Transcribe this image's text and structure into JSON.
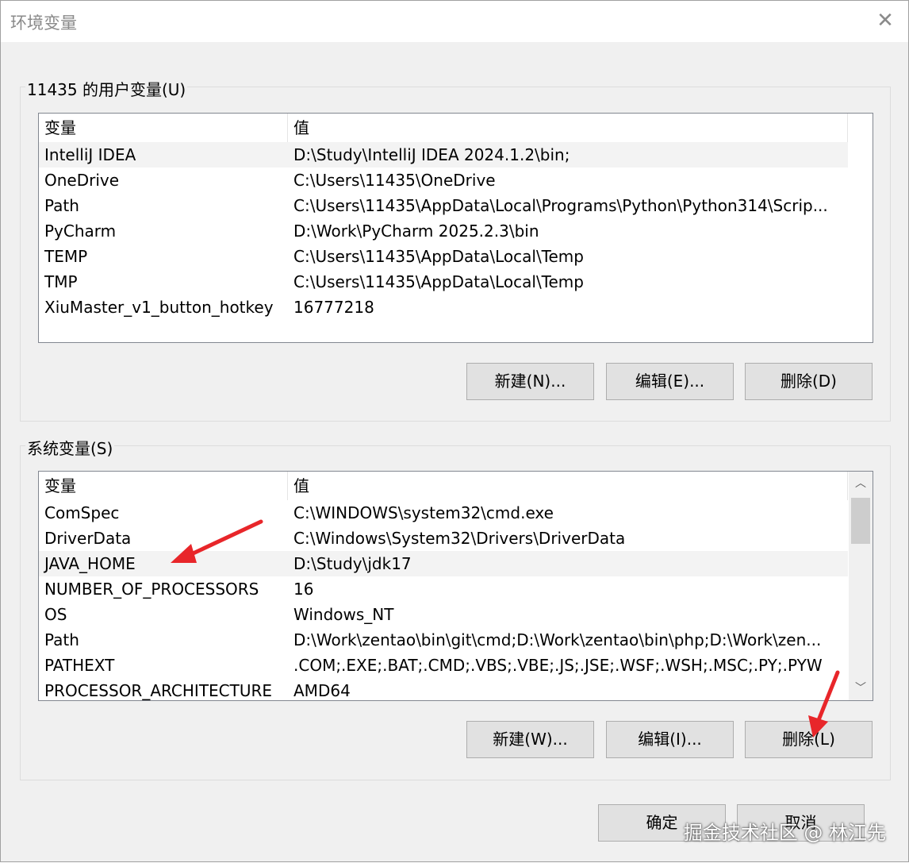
{
  "window": {
    "title": "环境变量",
    "close_icon": "close-icon"
  },
  "user_vars": {
    "label": "11435 的用户变量(U)",
    "columns": [
      "变量",
      "值"
    ],
    "rows": [
      {
        "name": "IntelliJ IDEA",
        "value": "D:\\Study\\IntelliJ IDEA 2024.1.2\\bin;"
      },
      {
        "name": "OneDrive",
        "value": "C:\\Users\\11435\\OneDrive"
      },
      {
        "name": "Path",
        "value": "C:\\Users\\11435\\AppData\\Local\\Programs\\Python\\Python314\\Scrip..."
      },
      {
        "name": "PyCharm",
        "value": "D:\\Work\\PyCharm 2025.2.3\\bin"
      },
      {
        "name": "TEMP",
        "value": "C:\\Users\\11435\\AppData\\Local\\Temp"
      },
      {
        "name": "TMP",
        "value": "C:\\Users\\11435\\AppData\\Local\\Temp"
      },
      {
        "name": "XiuMaster_v1_button_hotkey",
        "value": "16777218"
      }
    ],
    "selected_index": 0,
    "buttons": {
      "new": "新建(N)...",
      "edit": "编辑(E)...",
      "delete": "删除(D)"
    }
  },
  "system_vars": {
    "label": "系统变量(S)",
    "columns": [
      "变量",
      "值"
    ],
    "rows": [
      {
        "name": "ComSpec",
        "value": "C:\\WINDOWS\\system32\\cmd.exe"
      },
      {
        "name": "DriverData",
        "value": "C:\\Windows\\System32\\Drivers\\DriverData"
      },
      {
        "name": "JAVA_HOME",
        "value": "D:\\Study\\jdk17"
      },
      {
        "name": "NUMBER_OF_PROCESSORS",
        "value": "16"
      },
      {
        "name": "OS",
        "value": "Windows_NT"
      },
      {
        "name": "Path",
        "value": "D:\\Work\\zentao\\bin\\git\\cmd;D:\\Work\\zentao\\bin\\php;D:\\Work\\zen..."
      },
      {
        "name": "PATHEXT",
        "value": ".COM;.EXE;.BAT;.CMD;.VBS;.VBE;.JS;.JSE;.WSF;.WSH;.MSC;.PY;.PYW"
      },
      {
        "name": "PROCESSOR_ARCHITECTURE",
        "value": "AMD64"
      }
    ],
    "selected_index": 2,
    "buttons": {
      "new": "新建(W)...",
      "edit": "编辑(I)...",
      "delete": "删除(L)"
    },
    "scroll_up_icon": "chevron-up-icon",
    "scroll_down_icon": "chevron-down-icon"
  },
  "footer": {
    "ok": "确定",
    "cancel": "取消"
  },
  "watermark": "掘金技术社区 @ 林江先",
  "annotation_color": "#e8262a"
}
